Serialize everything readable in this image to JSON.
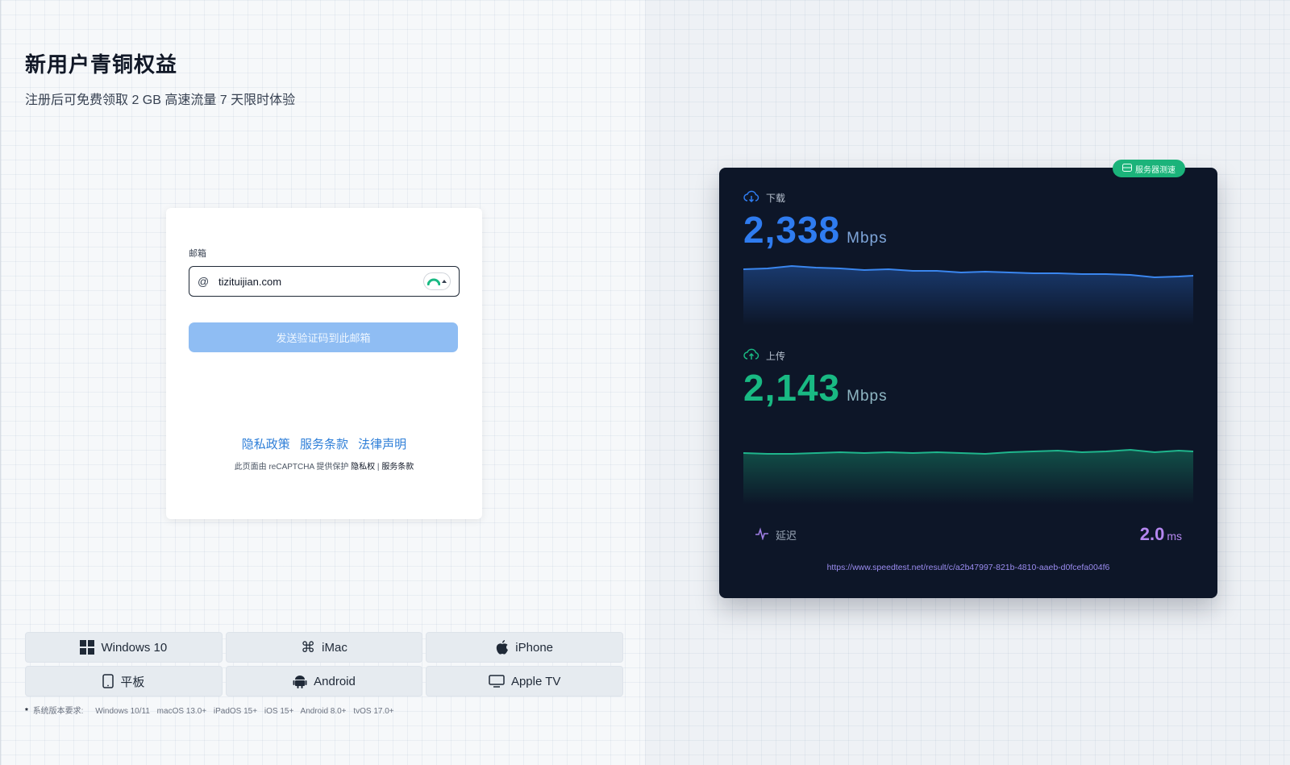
{
  "promo": {
    "title": "新用户青铜权益",
    "subtitle": "注册后可免费领取 2 GB 高速流量 7 天限时体验"
  },
  "login": {
    "email_label": "邮箱",
    "email_value": "tizituijian.com",
    "send_button": "发送验证码到此邮箱",
    "links": {
      "privacy": "隐私政策",
      "terms": "服务条款",
      "legal": "法律声明"
    },
    "recaptcha": {
      "prefix": "此页面由 reCAPTCHA 提供保护",
      "privacy": "隐私权",
      "separator": "|",
      "terms": "服务条款"
    }
  },
  "platforms": [
    {
      "label": "Windows 10",
      "icon": "windows-icon"
    },
    {
      "label": "iMac",
      "icon": "command-icon"
    },
    {
      "label": "iPhone",
      "icon": "apple-icon"
    },
    {
      "label": "平板",
      "icon": "tablet-icon"
    },
    {
      "label": "Android",
      "icon": "android-icon"
    },
    {
      "label": "Apple TV",
      "icon": "tv-icon"
    }
  ],
  "requirements": {
    "label": "系统版本要求:",
    "items": [
      "Windows 10/11",
      "macOS 13.0+",
      "iPadOS 15+",
      "iOS 15+",
      "Android 8.0+",
      "tvOS 17.0+"
    ]
  },
  "speedtest": {
    "badge": "服务器测速",
    "download": {
      "label": "下载",
      "value": "2,338",
      "unit": "Mbps",
      "color": "#2f7cf0"
    },
    "upload": {
      "label": "上传",
      "value": "2,143",
      "unit": "Mbps",
      "color": "#19b983"
    },
    "latency": {
      "label": "延迟",
      "value": "2.0",
      "unit": "ms",
      "color": "#b587f0"
    },
    "result_url": "https://www.speedtest.net/result/c/a2b47997-821b-4810-aaeb-d0fcefa004f6"
  },
  "colors": {
    "accent": "#2f7fd8",
    "button_disabled": "#8fbdf3",
    "card_dark": "#0d1628",
    "badge_green": "#1bb37a"
  }
}
